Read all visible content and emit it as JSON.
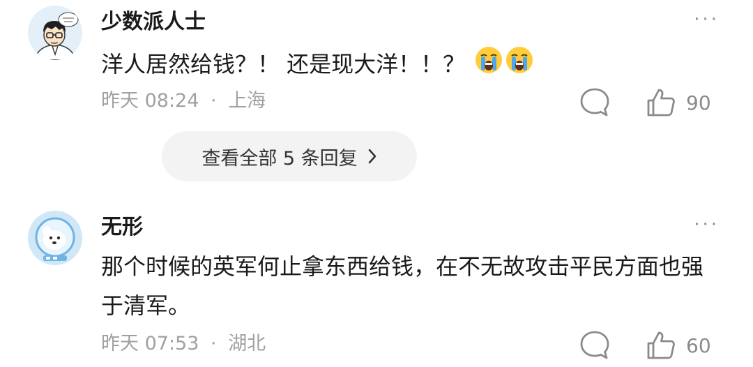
{
  "comments": [
    {
      "username": "少数派人士",
      "text": "洋人居然给钱？！ 还是现大洋！！？",
      "emoji": "crying-face-emoji",
      "time": "昨天 08:24",
      "separator": "·",
      "location": "上海",
      "likes": "90",
      "more": "···",
      "replies_label": "查看全部 5 条回复"
    },
    {
      "username": "无形",
      "text": "那个时候的英军何止拿东西给钱，在不无故攻击平民方面也强于清军。",
      "time": "昨天 07:53",
      "separator": "·",
      "location": "湖北",
      "likes": "60",
      "more": "···"
    }
  ],
  "icons": {
    "reply": "comment-bubble-icon",
    "like": "thumbs-up-icon",
    "chevron": "chevron-right-icon"
  },
  "colors": {
    "text_primary": "#1a1a1a",
    "text_meta": "#a0a0a0",
    "icon_gray": "#8a8a8a",
    "pill_bg": "#f3f3f3"
  }
}
